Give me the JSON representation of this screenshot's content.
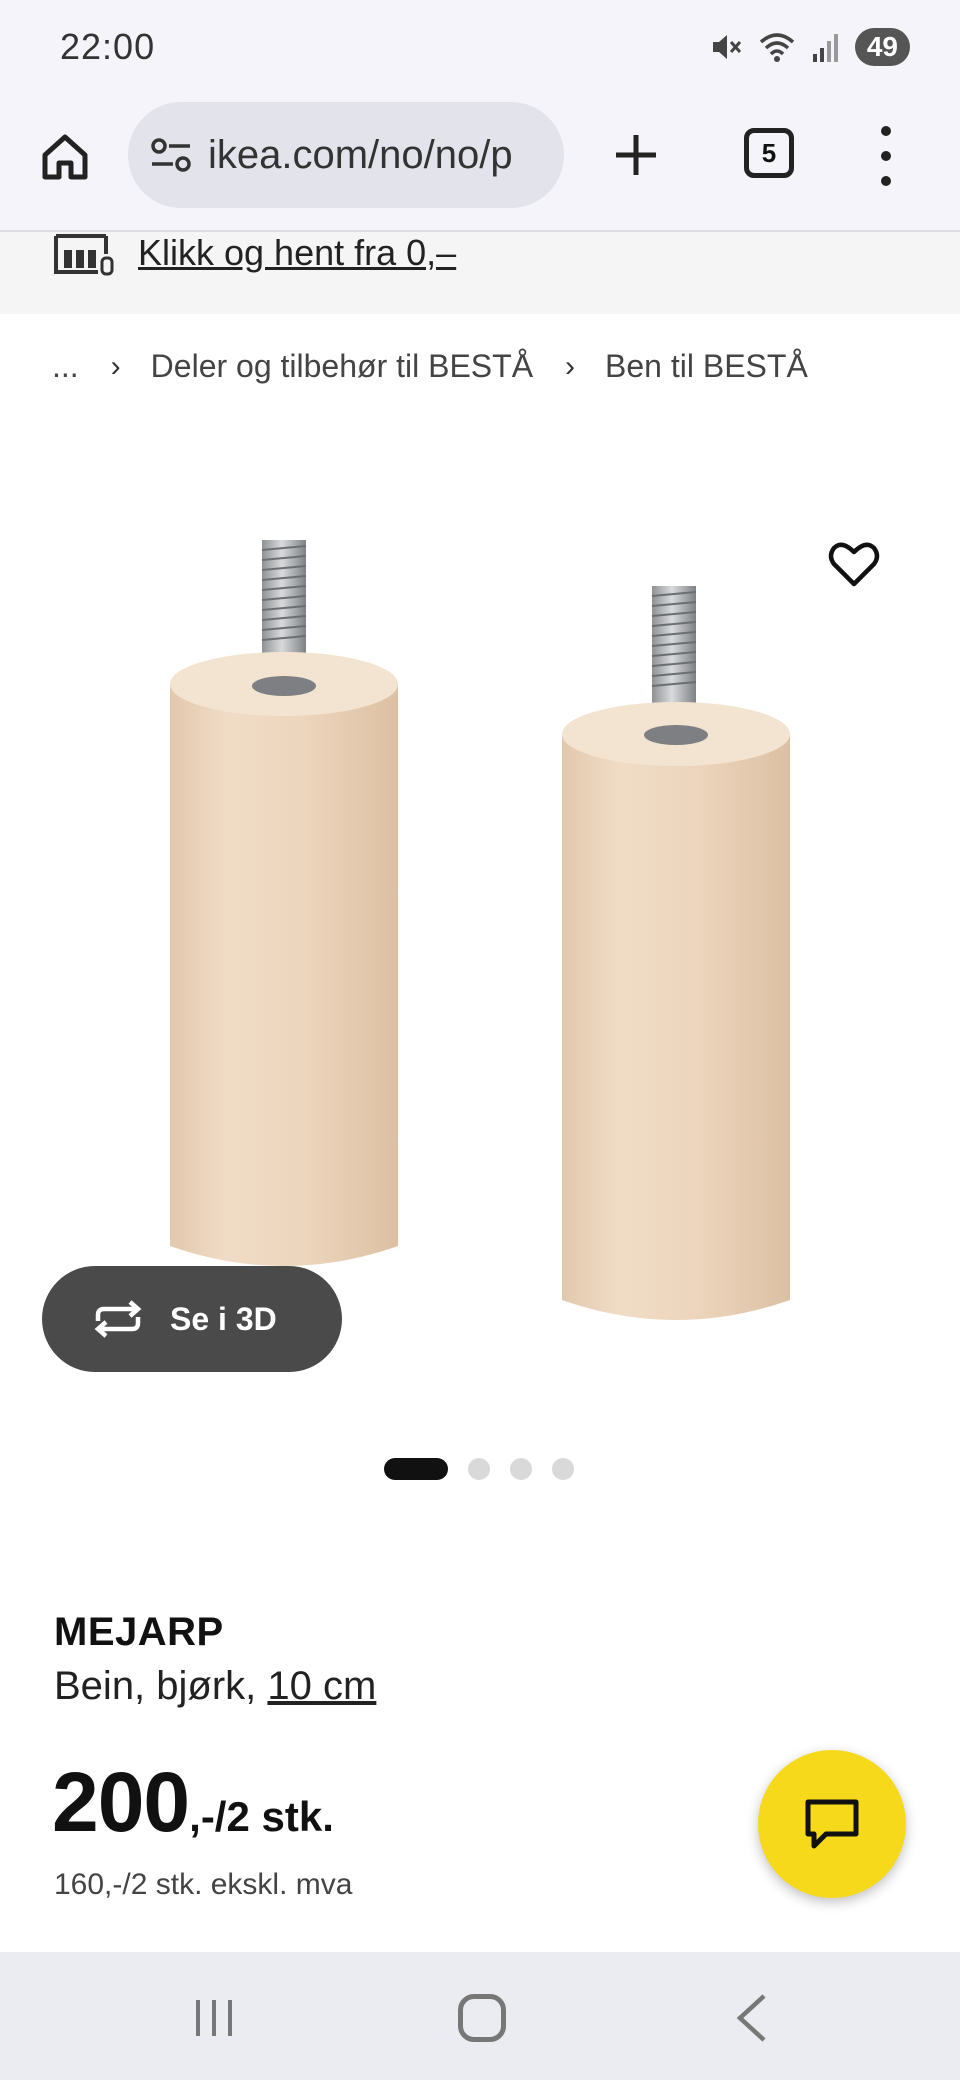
{
  "status_bar": {
    "time": "22:00",
    "battery": "49",
    "icons": [
      "mute-icon",
      "wifi-icon",
      "signal-icon"
    ]
  },
  "browser": {
    "url": "ikea.com/no/no/p",
    "tab_count": "5",
    "icons": [
      "home-icon",
      "site-settings-icon",
      "plus-icon",
      "tabs-icon",
      "more-menu-icon"
    ]
  },
  "pickup_banner": {
    "text": "Klikk og hent fra 0,–"
  },
  "breadcrumb": {
    "items": [
      "...",
      "Deler og tilbehør til BESTÅ",
      "Ben til BESTÅ"
    ]
  },
  "product": {
    "view_3d_label": "Se i 3D",
    "gallery_dot_count": 4,
    "gallery_active_index": 0,
    "name": "MEJARP",
    "description": "Bein, bjørk,",
    "size_link": "10 cm",
    "price": "200",
    "price_suffix": ",-/2 stk.",
    "price_ex_vat": "160,-/2 stk. ekskl. mva"
  },
  "colors": {
    "brand_yellow": "#f6d91b",
    "wood": "#ecd6bf",
    "button_dark": "#4a4a4a"
  }
}
